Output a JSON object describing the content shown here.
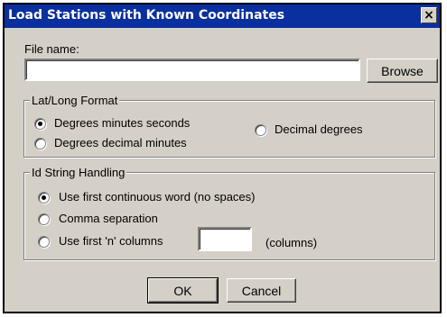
{
  "window": {
    "title": "Load Stations with Known Coordinates",
    "close_glyph": "✕"
  },
  "file": {
    "label": "File name:",
    "value": "",
    "browse_label": "Browse"
  },
  "latlong": {
    "legend": "Lat/Long Format",
    "options": [
      {
        "label": "Degrees minutes seconds",
        "selected": true
      },
      {
        "label": "Degrees decimal minutes",
        "selected": false
      },
      {
        "label": "Decimal degrees",
        "selected": false
      }
    ]
  },
  "idstring": {
    "legend": "Id String Handling",
    "options": [
      {
        "label": "Use first continuous word (no spaces)",
        "selected": true
      },
      {
        "label": "Comma separation",
        "selected": false
      },
      {
        "label": "Use first 'n' columns",
        "selected": false
      }
    ],
    "columns_value": "",
    "columns_suffix": "(columns)"
  },
  "buttons": {
    "ok": "OK",
    "cancel": "Cancel"
  }
}
